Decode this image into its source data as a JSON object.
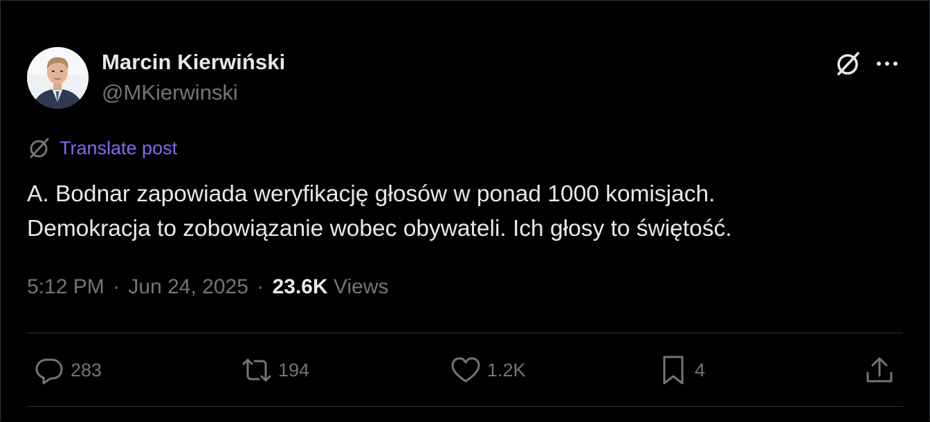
{
  "author": {
    "display_name": "Marcin Kierwiński",
    "handle": "@MKierwinski",
    "avatar_icon": "profile-photo"
  },
  "header_actions": {
    "grok_icon": "grok-icon",
    "more_icon": "more-dots-icon"
  },
  "translate": {
    "label": "Translate post",
    "color": "#7d6cf7"
  },
  "post": {
    "lines": [
      "A. Bodnar zapowiada weryfikację głosów w ponad 1000 komisjach.",
      "Demokracja to zobowiązanie wobec obywateli. Ich głosy to świętość."
    ]
  },
  "meta": {
    "time": "5:12 PM",
    "date": "Jun 24, 2025",
    "separator": "·",
    "views_count": "23.6K",
    "views_label": "Views"
  },
  "actions": {
    "replies": {
      "icon": "reply-icon",
      "count": "283"
    },
    "reposts": {
      "icon": "repost-icon",
      "count": "194"
    },
    "likes": {
      "icon": "like-icon",
      "count": "1.2K"
    },
    "bookmarks": {
      "icon": "bookmark-icon",
      "count": "4"
    },
    "share": {
      "icon": "share-icon"
    }
  },
  "colors": {
    "background": "#000000",
    "primary_text": "#e7e9ea",
    "secondary_text": "#71767b",
    "divider": "#2f3336"
  }
}
